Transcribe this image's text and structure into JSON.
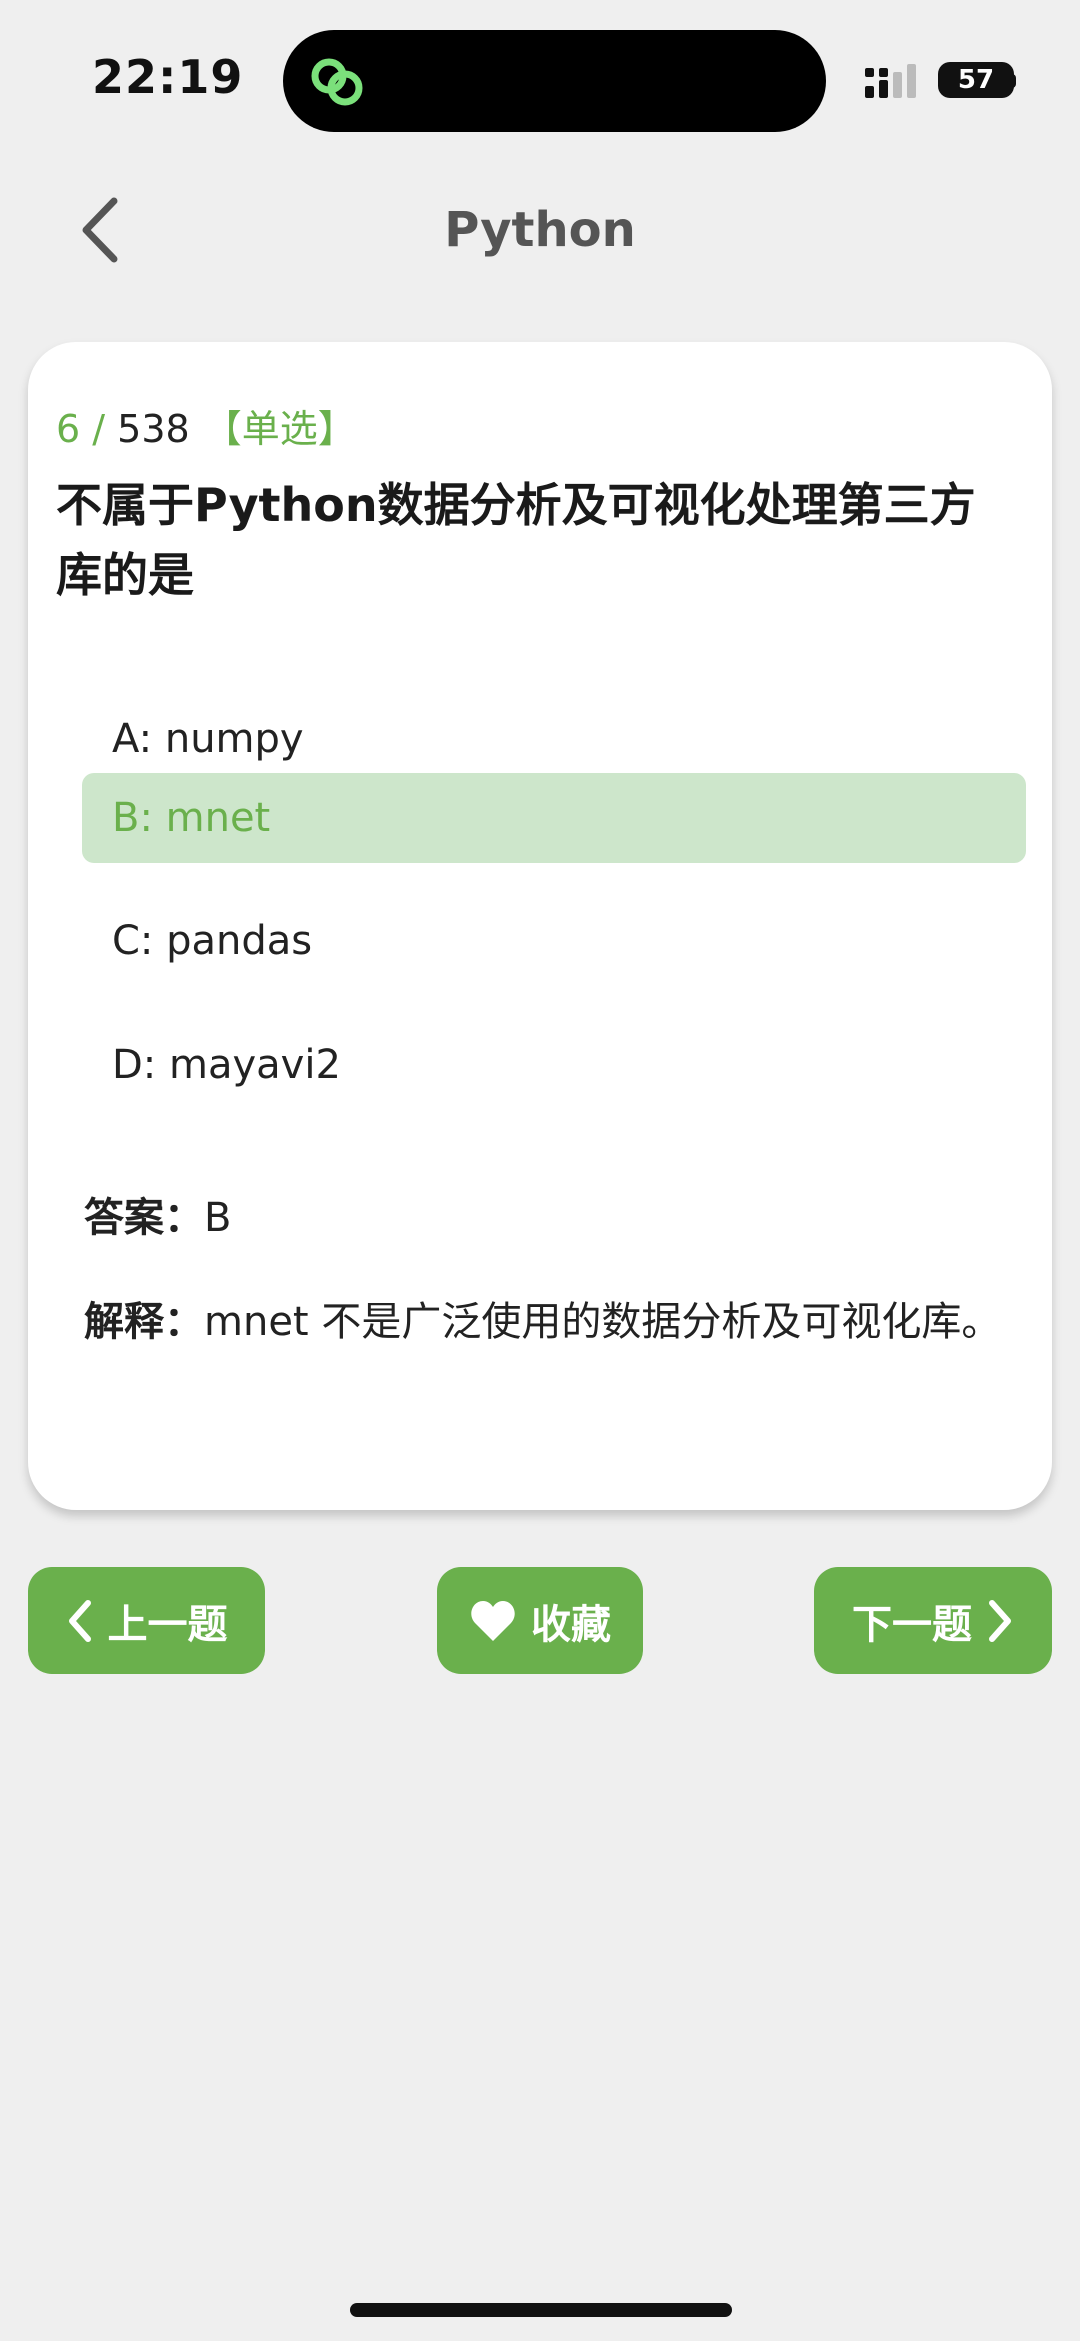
{
  "status_bar": {
    "time": "22:19",
    "battery": "57"
  },
  "nav": {
    "title": "Python"
  },
  "question": {
    "index": "6",
    "separator": " / ",
    "total": "538",
    "type": "【单选】",
    "text": "不属于Python数据分析及可视化处理第三方库的是",
    "options": [
      {
        "label": "A: numpy",
        "selected": false
      },
      {
        "label": "B: mnet",
        "selected": true
      },
      {
        "label": "C: pandas",
        "selected": false
      },
      {
        "label": "D: mayavi2",
        "selected": false
      }
    ],
    "answer_label": "答案：",
    "answer_value": "B",
    "explain_label": "解释：",
    "explain_value": "mnet 不是广泛使用的数据分析及可视化库。"
  },
  "buttons": {
    "prev": "上一题",
    "favorite": "收藏",
    "next": "下一题"
  },
  "colors": {
    "accent": "#6ab04c",
    "selected_bg": "#cde6cb",
    "background": "#efefef"
  }
}
